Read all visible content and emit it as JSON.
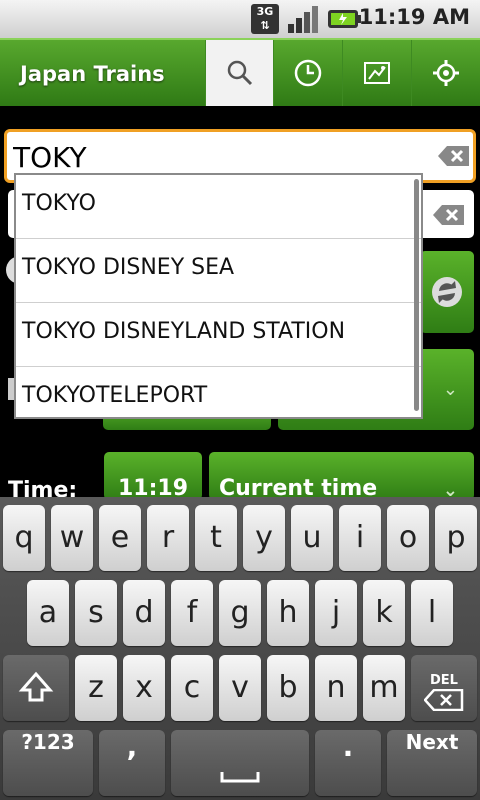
{
  "status_bar": {
    "network": "3G",
    "time": "11:19 AM"
  },
  "app": {
    "title": "Japan Trains"
  },
  "toolbar": {
    "search_icon": "search-icon",
    "history_icon": "clock-icon",
    "map_icon": "map-icon",
    "settings_icon": "gear-icon"
  },
  "search": {
    "value": "TOKY"
  },
  "suggestions": [
    "TOKYO",
    "TOKYO DISNEY SEA",
    "TOKYO DISNEYLAND STATION",
    "TOKYOTELEPORT"
  ],
  "form": {
    "time_label": "Time:",
    "time_value": "11:19",
    "time_mode": "Current time"
  },
  "keyboard": {
    "row1": [
      "q",
      "w",
      "e",
      "r",
      "t",
      "y",
      "u",
      "i",
      "o",
      "p"
    ],
    "row2": [
      "a",
      "s",
      "d",
      "f",
      "g",
      "h",
      "j",
      "k",
      "l"
    ],
    "row3": [
      "z",
      "x",
      "c",
      "v",
      "b",
      "n",
      "m"
    ],
    "del_label": "DEL",
    "symbols_label": "?123",
    "comma_label": ",",
    "period_label": ".",
    "next_label": "Next"
  },
  "colors": {
    "accent_green": "#3f8f1d",
    "focus_orange": "#f0a024"
  }
}
